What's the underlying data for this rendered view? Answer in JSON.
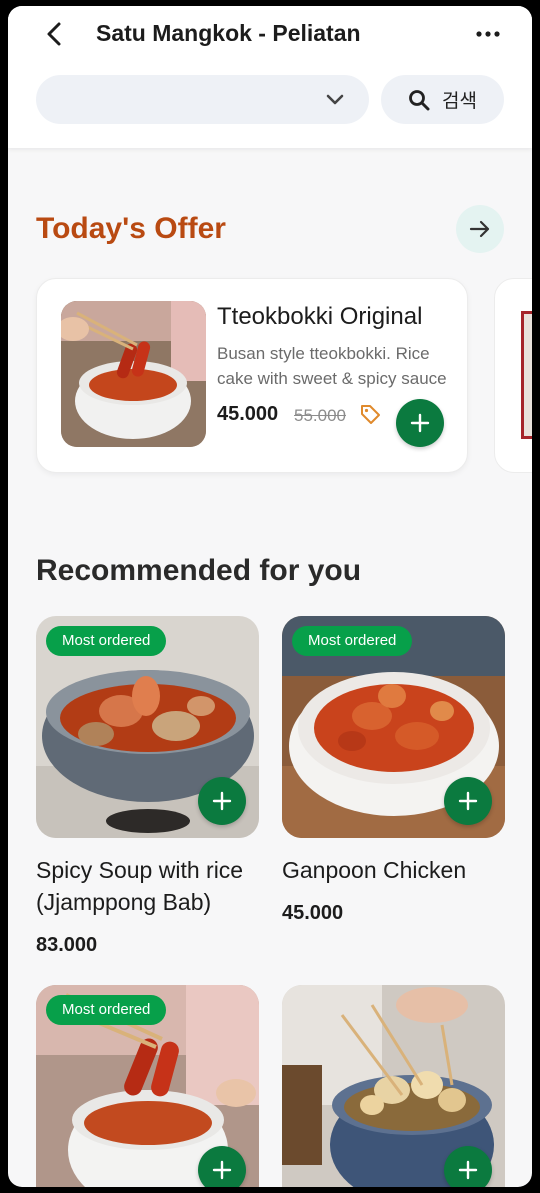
{
  "header": {
    "title": "Satu Mangkok - Peliatan",
    "dropdown_value": "",
    "search_label": "검색"
  },
  "offer": {
    "title": "Today's Offer",
    "item": {
      "name": "Tteokbokki Original",
      "description": "Busan style tteokbokki. Rice cake with sweet & spicy sauce",
      "price": "45.000",
      "old_price": "55.000"
    }
  },
  "recommended": {
    "title": "Recommended for you",
    "items": [
      {
        "badge": "Most ordered",
        "name": "Spicy Soup with rice (Jjamppong Bab)",
        "price": "83.000"
      },
      {
        "badge": "Most ordered",
        "name": "Ganpoon Chicken",
        "price": "45.000"
      },
      {
        "badge": "Most ordered",
        "name": "",
        "price": ""
      },
      {
        "badge": "",
        "name": "",
        "price": ""
      }
    ]
  },
  "colors": {
    "accent_green": "#0b7a3f",
    "badge_green": "#07a04a",
    "offer_title": "#b94a12"
  }
}
